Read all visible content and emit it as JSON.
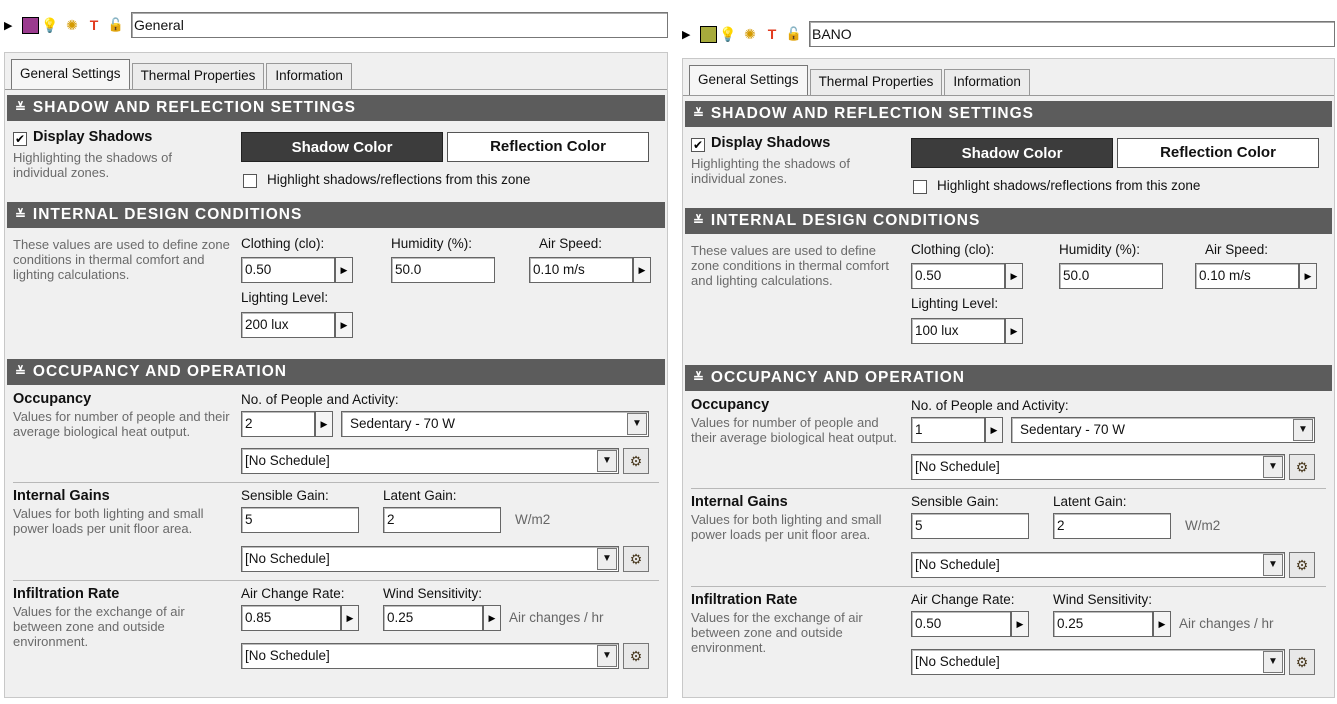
{
  "panels": [
    {
      "zone_name": "General",
      "swatch_color": "#9b3b8f",
      "tabs": [
        "General Settings",
        "Thermal Properties",
        "Information"
      ],
      "shadow": {
        "header": "SHADOW AND REFLECTION SETTINGS",
        "display_label": "Display Shadows",
        "display_checked": "✔",
        "desc": "Highlighting the shadows of individual zones.",
        "shadow_btn": "Shadow Color",
        "reflection_btn": "Reflection Color",
        "highlight_label": "Highlight shadows/reflections from this zone"
      },
      "internal": {
        "header": "INTERNAL DESIGN CONDITIONS",
        "desc": "These values are used to define zone conditions in thermal comfort and lighting calculations.",
        "clothing_label": "Clothing (clo):",
        "clothing_value": "0.50",
        "humidity_label": "Humidity (%):",
        "humidity_value": "50.0",
        "airspeed_label": "Air Speed:",
        "airspeed_value": "0.10 m/s",
        "lighting_label": "Lighting Level:",
        "lighting_value": "200 lux"
      },
      "occupancy": {
        "header": "OCCUPANCY AND OPERATION",
        "occ_title": "Occupancy",
        "occ_desc": "Values for number of people and their average biological heat output.",
        "people_label": "No. of People and Activity:",
        "people_value": "2",
        "activity_value": "Sedentary  -  70 W",
        "occ_schedule": "[No Schedule]",
        "gains_title": "Internal Gains",
        "gains_desc": "Values for both lighting and small power loads per unit floor area.",
        "sensible_label": "Sensible Gain:",
        "sensible_value": "5",
        "latent_label": "Latent Gain:",
        "latent_value": "2",
        "gains_unit": "W/m2",
        "gains_schedule": "[No Schedule]",
        "inf_title": "Infiltration Rate",
        "inf_desc": "Values for the exchange of air between zone and outside environment.",
        "acr_label": "Air Change Rate:",
        "acr_value": "0.85",
        "wind_label": "Wind Sensitivity:",
        "wind_value": "0.25",
        "inf_unit": "Air changes / hr",
        "inf_schedule": "[No Schedule]"
      }
    },
    {
      "zone_name": "BANO",
      "swatch_color": "#a7ab3c",
      "tabs": [
        "General Settings",
        "Thermal Properties",
        "Information"
      ],
      "shadow": {
        "header": "SHADOW AND REFLECTION SETTINGS",
        "display_label": "Display Shadows",
        "display_checked": "✔",
        "desc": "Highlighting the shadows of individual zones.",
        "shadow_btn": "Shadow Color",
        "reflection_btn": "Reflection Color",
        "highlight_label": "Highlight shadows/reflections from this zone"
      },
      "internal": {
        "header": "INTERNAL DESIGN CONDITIONS",
        "desc": "These values are used to define zone conditions in thermal comfort and lighting calculations.",
        "clothing_label": "Clothing (clo):",
        "clothing_value": "0.50",
        "humidity_label": "Humidity (%):",
        "humidity_value": "50.0",
        "airspeed_label": "Air Speed:",
        "airspeed_value": "0.10 m/s",
        "lighting_label": "Lighting Level:",
        "lighting_value": "100 lux"
      },
      "occupancy": {
        "header": "OCCUPANCY AND OPERATION",
        "occ_title": "Occupancy",
        "occ_desc": "Values for number of people and their average biological heat output.",
        "people_label": "No. of People and Activity:",
        "people_value": "1",
        "activity_value": "Sedentary  -  70 W",
        "occ_schedule": "[No Schedule]",
        "gains_title": "Internal Gains",
        "gains_desc": "Values for both lighting and small power loads per unit floor area.",
        "sensible_label": "Sensible Gain:",
        "sensible_value": "5",
        "latent_label": "Latent Gain:",
        "latent_value": "2",
        "gains_unit": "W/m2",
        "gains_schedule": "[No Schedule]",
        "inf_title": "Infiltration Rate",
        "inf_desc": "Values for the exchange of air between zone and outside environment.",
        "acr_label": "Air Change Rate:",
        "acr_value": "0.50",
        "wind_label": "Wind Sensitivity:",
        "wind_value": "0.25",
        "inf_unit": "Air changes / hr",
        "inf_schedule": "[No Schedule]"
      }
    }
  ]
}
